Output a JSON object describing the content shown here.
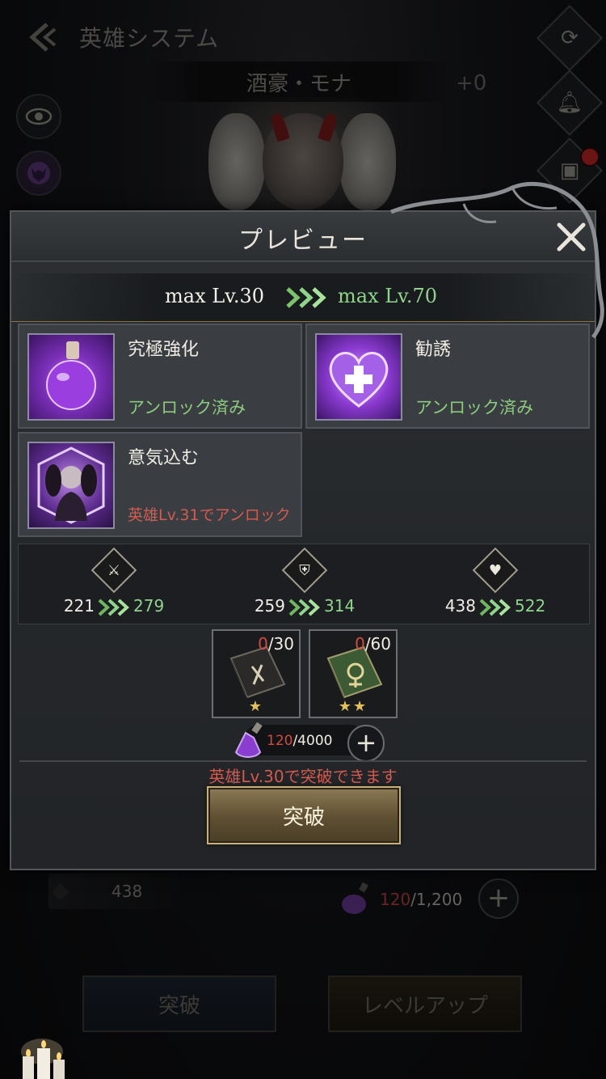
{
  "screen": {
    "title": "英雄システム",
    "hero_name": "酒豪・モナ",
    "hero_plus": "+0"
  },
  "background": {
    "stat_hp": "438",
    "potion_current": "120",
    "potion_total": "/1,200",
    "btn_breakthrough": "突破",
    "btn_levelup": "レベルアップ"
  },
  "modal": {
    "title": "プレビュー",
    "max_from": "max Lv.30",
    "max_to": "max Lv.70",
    "skills": [
      {
        "name": "究極強化",
        "status": "アンロック済み",
        "locked": false
      },
      {
        "name": "勧誘",
        "status": "アンロック済み",
        "locked": false
      },
      {
        "name": "意気込む",
        "status": "英雄Lv.31でアンロック",
        "locked": true
      }
    ],
    "stats": [
      {
        "icon": "attack-icon",
        "from": "221",
        "to": "279"
      },
      {
        "icon": "defense-icon",
        "from": "259",
        "to": "314"
      },
      {
        "icon": "health-icon",
        "from": "438",
        "to": "522"
      }
    ],
    "books": [
      {
        "have": "0",
        "need": "/30",
        "stars": "★"
      },
      {
        "have": "0",
        "need": "/60",
        "stars": "★★"
      }
    ],
    "cost": {
      "current": "120",
      "total": "/4000"
    },
    "note": "英雄Lv.30で突破できます",
    "button": "突破"
  },
  "colors": {
    "accent_green": "#8ed48a",
    "warning_red": "#d25a4e",
    "gold": "#c9b078"
  }
}
